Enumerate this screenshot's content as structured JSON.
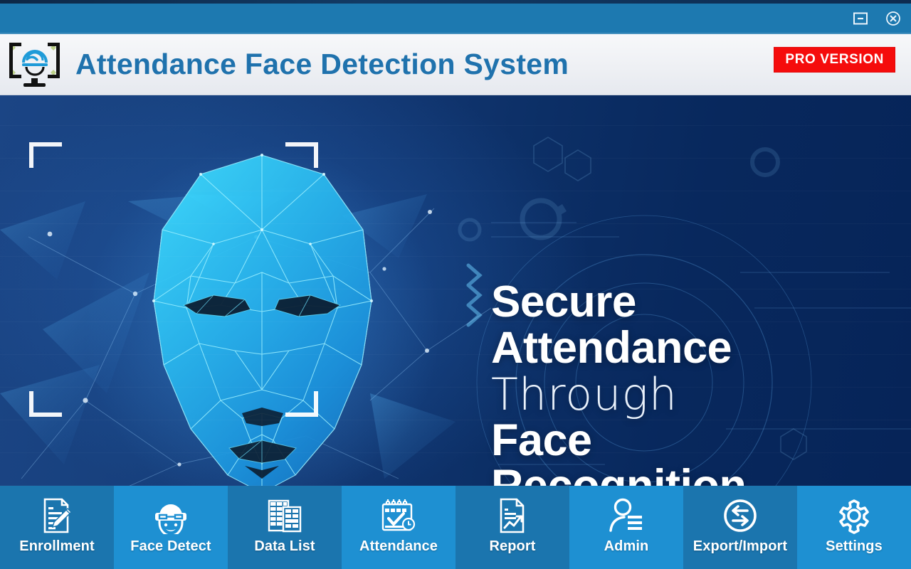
{
  "window": {
    "title": "Attendance Face Detection System",
    "controls": [
      {
        "name": "minimize",
        "label": "Minimize",
        "icon": "minimize-icon"
      },
      {
        "name": "close",
        "label": "Close",
        "icon": "close-icon"
      }
    ],
    "colors": {
      "titlebar": "#1d79b0",
      "header_bg": "#eef0f4",
      "title_text": "#1f72ad",
      "badge_bg": "#f50c0c",
      "nav_dark": "#1b75ae",
      "nav_light": "#1e90d2",
      "hero_left": "#1a4280",
      "hero_right": "#062357",
      "face_cyan": "#2fd0f5"
    }
  },
  "header": {
    "logo_icon": "face-scan-monitor-logo",
    "title": "Attendance Face Detection System",
    "badge": "PRO VERSION"
  },
  "hero": {
    "graphic": "low-poly-wireframe-face",
    "headline": [
      {
        "text": "Secure",
        "style": "bold"
      },
      {
        "text": "Attendance",
        "style": "bold"
      },
      {
        "text": "Through",
        "style": "thin"
      },
      {
        "text": "Face",
        "style": "bold"
      },
      {
        "text": "Recognition",
        "style": "bold"
      }
    ]
  },
  "nav": {
    "items": [
      {
        "label": "Enrollment",
        "icon": "document-pencil-icon",
        "shade": "dark"
      },
      {
        "label": "Face Detect",
        "icon": "face-scan-icon",
        "shade": "light"
      },
      {
        "label": "Data List",
        "icon": "table-grid-icon",
        "shade": "dark"
      },
      {
        "label": "Attendance",
        "icon": "calendar-check-icon",
        "shade": "light"
      },
      {
        "label": "Report",
        "icon": "report-chart-icon",
        "shade": "dark"
      },
      {
        "label": "Admin",
        "icon": "user-list-icon",
        "shade": "light"
      },
      {
        "label": "Export/Import",
        "icon": "exchange-arrows-icon",
        "shade": "dark"
      },
      {
        "label": "Settings",
        "icon": "gear-icon",
        "shade": "light"
      }
    ]
  }
}
